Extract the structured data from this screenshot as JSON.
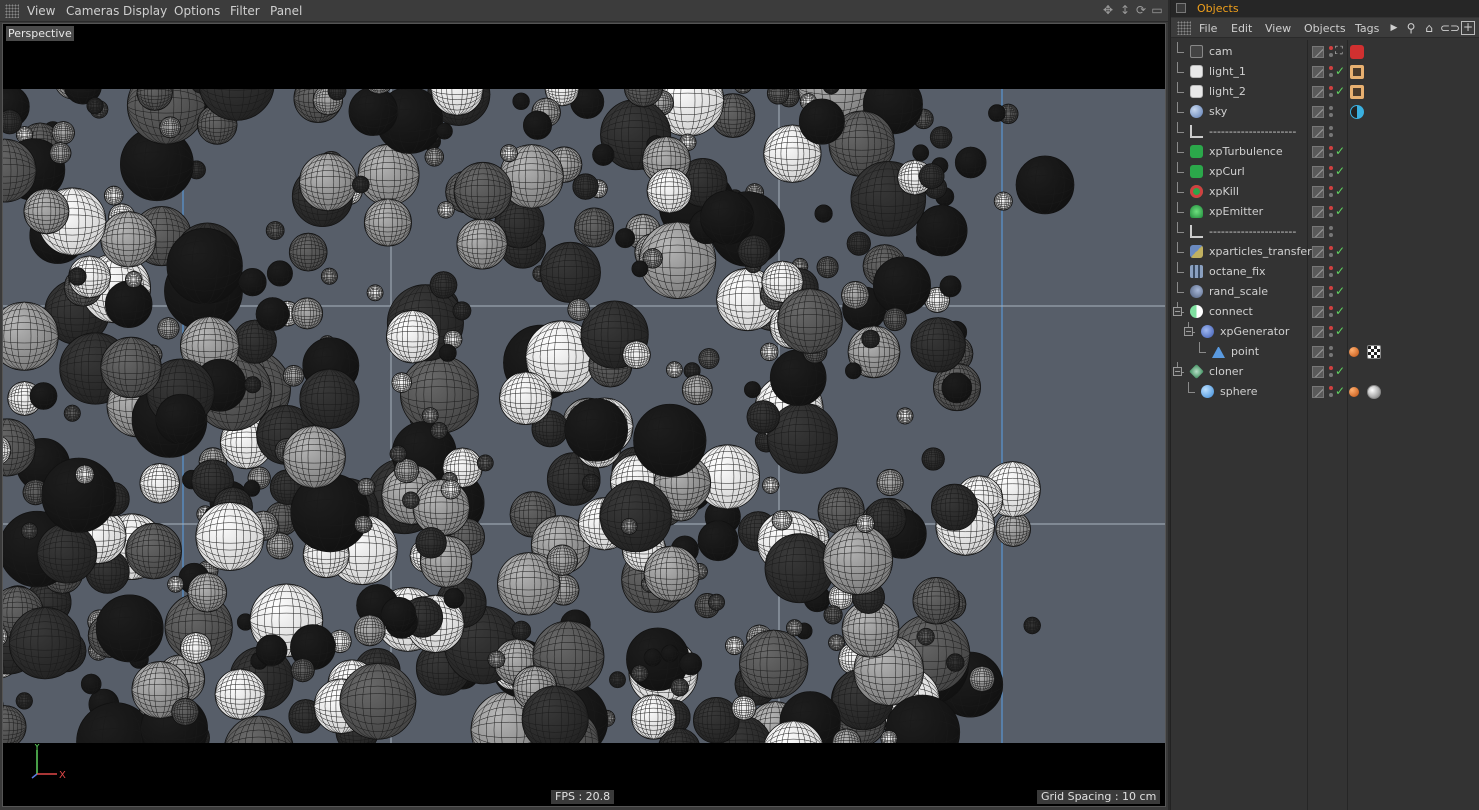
{
  "viewport": {
    "menu": [
      "View",
      "Cameras",
      "Display",
      "Options",
      "Filter",
      "Panel"
    ],
    "title": "Perspective",
    "axis_x": "X",
    "axis_y": "Y",
    "fps": "FPS : 20.8",
    "grid_spacing": "Grid Spacing : 10 cm",
    "nav_icons": [
      "move-view-icon",
      "dolly-view-icon",
      "rotate-view-icon",
      "toggle-view-icon"
    ]
  },
  "objects_panel": {
    "tab_title": "Objects",
    "menu": [
      "File",
      "Edit",
      "View",
      "Objects",
      "Tags"
    ],
    "tools": [
      "more-arrow-icon",
      "search-icon",
      "home-icon",
      "link-icon",
      "new-window-icon"
    ],
    "rows": [
      {
        "name": "cam",
        "icon": "camera-icon",
        "depth": 0,
        "check": "x",
        "tag": "camera-tag"
      },
      {
        "name": "light_1",
        "icon": "light-icon",
        "depth": 0,
        "check": "green",
        "tag": "light-tag"
      },
      {
        "name": "light_2",
        "icon": "light-icon",
        "depth": 0,
        "check": "green",
        "tag": "light-tag"
      },
      {
        "name": "sky",
        "icon": "sky-icon",
        "depth": 0,
        "check": "none",
        "tag": "sky-tag"
      },
      {
        "name": "----------------------",
        "icon": "null-icon",
        "depth": 0,
        "check": "none",
        "tag": ""
      },
      {
        "name": "xpTurbulence",
        "icon": "xp-modifier-icon",
        "depth": 0,
        "check": "green",
        "tag": ""
      },
      {
        "name": "xpCurl",
        "icon": "xp-modifier-icon",
        "depth": 0,
        "check": "green",
        "tag": ""
      },
      {
        "name": "xpKill",
        "icon": "xp-kill-icon",
        "depth": 0,
        "check": "green",
        "tag": ""
      },
      {
        "name": "xpEmitter",
        "icon": "xp-emitter-icon",
        "depth": 0,
        "check": "green",
        "tag": ""
      },
      {
        "name": "----------------------",
        "icon": "null-icon",
        "depth": 0,
        "check": "none",
        "tag": ""
      },
      {
        "name": "xparticles_transfer",
        "icon": "python-icon",
        "depth": 0,
        "check": "green",
        "tag": ""
      },
      {
        "name": "octane_fix",
        "icon": "effector-icon",
        "depth": 0,
        "check": "green",
        "tag": ""
      },
      {
        "name": "rand_scale",
        "icon": "random-effector-icon",
        "depth": 0,
        "check": "green",
        "tag": ""
      },
      {
        "name": "connect",
        "icon": "connect-icon",
        "depth": 0,
        "check": "green",
        "tag": "",
        "expander": "-"
      },
      {
        "name": "xpGenerator",
        "icon": "xp-generator-icon",
        "depth": 1,
        "check": "green",
        "tag": "",
        "expander": "-"
      },
      {
        "name": "point",
        "icon": "point-icon",
        "depth": 2,
        "check": "none",
        "tag": "material-tags"
      },
      {
        "name": "cloner",
        "icon": "cloner-icon",
        "depth": 0,
        "check": "green",
        "tag": "",
        "expander": "-"
      },
      {
        "name": "sphere",
        "icon": "sphere-icon",
        "depth": 1,
        "check": "green",
        "tag": "sphere-material-tags"
      }
    ]
  },
  "colors": {
    "accent_orange": "#f0a01c",
    "check_green": "#5fd35f",
    "viewport_bg": "#575e69",
    "guide_blue": "#5aa0e6"
  }
}
